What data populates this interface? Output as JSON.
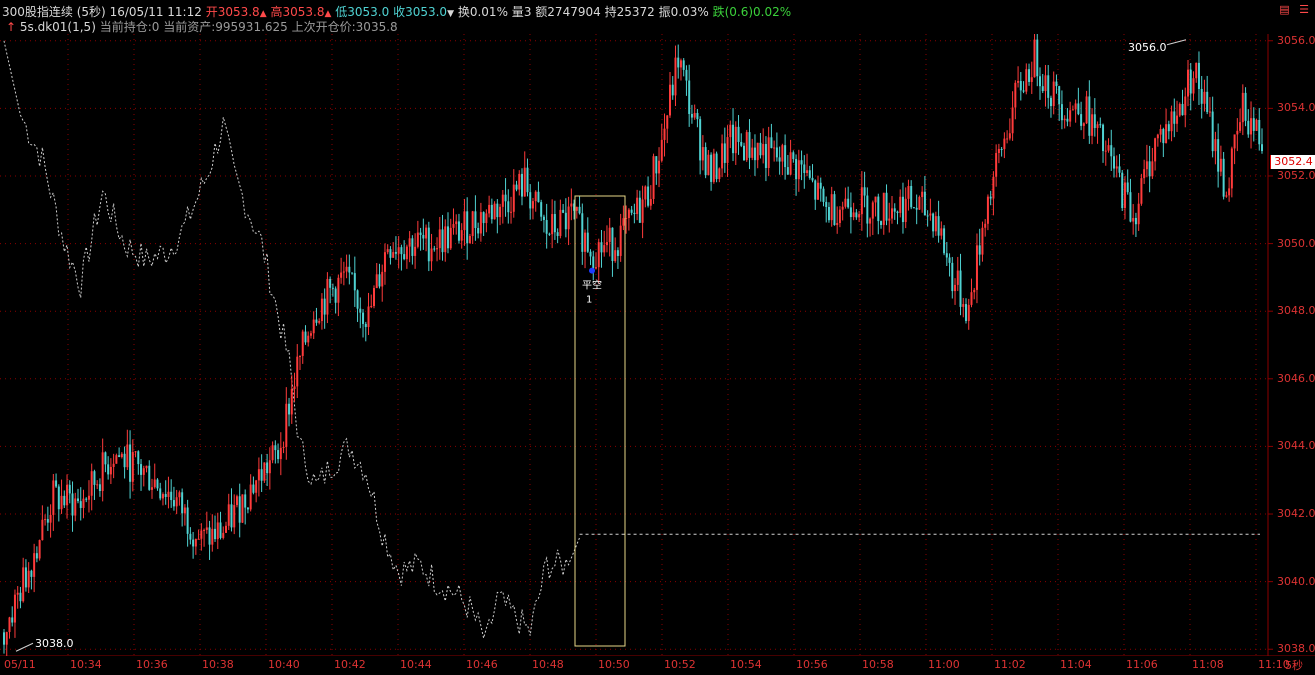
{
  "header": {
    "name": "300股指连续",
    "period": "(5秒)",
    "datetime": "16/05/11 11:12",
    "open_label": "开",
    "open": "3053.8",
    "high_label": "高",
    "high": "3053.8",
    "low_label": "低",
    "low": "3053.0",
    "close_label": "收",
    "close": "3053.0",
    "turnover_label": "换",
    "turnover": "0.01%",
    "volume_label": "量",
    "volume": "3",
    "amount_label": "额",
    "amount": "2747904",
    "oi_label": "持",
    "oi": "25372",
    "amplitude_label": "振",
    "amplitude": "0.03%",
    "change_label": "跌",
    "change": "(0.6)0.02%",
    "arrow_up": "▲",
    "arrow_down": "▼"
  },
  "strategy": {
    "icon_arrow": "↑",
    "name": "5s.dk01(1,5)",
    "position_label": "当前持仓:",
    "position": "0",
    "assets_label": "当前资产:",
    "assets": "995931.625",
    "last_open_label": "上次开仓价:",
    "last_open": "3035.8"
  },
  "annotations": {
    "high_label": "3056.0",
    "low_label": "3038.0",
    "signal_label": "平空",
    "signal_count": "1"
  },
  "colors": {
    "up": "#ff3b3b",
    "down": "#4fd2d2",
    "grid": "#8b0000",
    "axis_text": "#dd3333",
    "box": "#e8d888",
    "signal": "#1e3cff"
  },
  "current_price": "3052.4",
  "axis_period": "5秒",
  "chart_data": {
    "type": "candlestick",
    "ylim": [
      3037.8,
      3056.2
    ],
    "y_ticks": [
      "3038.0",
      "3040.0",
      "3042.0",
      "3044.0",
      "3046.0",
      "3048.0",
      "3050.0",
      "3052.0",
      "3054.0",
      "3056.0"
    ],
    "x_ticks": [
      "05/11",
      "10:34",
      "10:36",
      "10:38",
      "10:40",
      "10:42",
      "10:44",
      "10:46",
      "10:48",
      "10:50",
      "10:52",
      "10:54",
      "10:56",
      "10:58",
      "11:00",
      "11:02",
      "11:04",
      "11:06",
      "11:08",
      "11:10"
    ],
    "close_anchors": [
      [
        0,
        3038.5
      ],
      [
        8,
        3040.2
      ],
      [
        18,
        3042.5
      ],
      [
        28,
        3042.3
      ],
      [
        40,
        3043.8
      ],
      [
        52,
        3043.2
      ],
      [
        62,
        3042.5
      ],
      [
        72,
        3041.2
      ],
      [
        80,
        3041.5
      ],
      [
        90,
        3042.8
      ],
      [
        100,
        3043.8
      ],
      [
        106,
        3046.0
      ],
      [
        113,
        3048.0
      ],
      [
        124,
        3049.0
      ],
      [
        133,
        3047.8
      ],
      [
        140,
        3050.0
      ],
      [
        155,
        3050.0
      ],
      [
        165,
        3050.3
      ],
      [
        174,
        3050.8
      ],
      [
        182,
        3051.2
      ],
      [
        190,
        3051.8
      ],
      [
        198,
        3050.3
      ],
      [
        207,
        3050.8
      ],
      [
        215,
        3049.8
      ],
      [
        222,
        3050.0
      ],
      [
        228,
        3050.5
      ],
      [
        235,
        3051.5
      ],
      [
        240,
        3053.0
      ],
      [
        246,
        3055.5
      ],
      [
        252,
        3053.5
      ],
      [
        258,
        3052.0
      ],
      [
        265,
        3053.0
      ],
      [
        275,
        3052.8
      ],
      [
        282,
        3052.5
      ],
      [
        290,
        3052.3
      ],
      [
        300,
        3051.0
      ],
      [
        310,
        3051.3
      ],
      [
        318,
        3051.0
      ],
      [
        330,
        3051.2
      ],
      [
        340,
        3050.8
      ],
      [
        346,
        3049.0
      ],
      [
        352,
        3048.0
      ],
      [
        358,
        3051.0
      ],
      [
        364,
        3052.8
      ],
      [
        370,
        3054.5
      ],
      [
        376,
        3055.5
      ],
      [
        382,
        3054.5
      ],
      [
        388,
        3054.0
      ],
      [
        394,
        3054.0
      ],
      [
        400,
        3053.0
      ],
      [
        406,
        3052.0
      ],
      [
        412,
        3050.8
      ],
      [
        420,
        3053.0
      ],
      [
        428,
        3053.8
      ],
      [
        434,
        3055.2
      ],
      [
        440,
        3053.5
      ],
      [
        446,
        3051.5
      ],
      [
        452,
        3054.0
      ],
      [
        459,
        3053.0
      ]
    ],
    "shadow_line_anchors": [
      [
        0,
        3056.0
      ],
      [
        6,
        3053.8
      ],
      [
        14,
        3052.5
      ],
      [
        22,
        3050.0
      ],
      [
        28,
        3048.8
      ],
      [
        36,
        3051.5
      ],
      [
        44,
        3050.0
      ],
      [
        52,
        3049.5
      ],
      [
        60,
        3049.8
      ],
      [
        66,
        3050.5
      ],
      [
        74,
        3052.0
      ],
      [
        80,
        3053.5
      ],
      [
        84,
        3052.0
      ],
      [
        94,
        3050.0
      ],
      [
        104,
        3046.5
      ],
      [
        108,
        3044.0
      ],
      [
        114,
        3042.8
      ],
      [
        120,
        3043.5
      ],
      [
        126,
        3044.0
      ],
      [
        132,
        3043.3
      ],
      [
        138,
        3041.5
      ],
      [
        144,
        3040.3
      ],
      [
        152,
        3040.5
      ],
      [
        158,
        3040.0
      ],
      [
        164,
        3039.7
      ],
      [
        170,
        3039.2
      ],
      [
        176,
        3038.2
      ],
      [
        180,
        3039.5
      ],
      [
        186,
        3039.0
      ],
      [
        192,
        3038.5
      ],
      [
        198,
        3040.5
      ],
      [
        206,
        3040.5
      ],
      [
        210,
        3041.3
      ],
      [
        459,
        3041.3
      ]
    ],
    "n_bars": 460,
    "signal": {
      "label": "平空",
      "count": 1,
      "price": 3049.2
    },
    "high_annotation": 3056.0,
    "low_annotation": 3038.0,
    "reference_price": 3041.4
  }
}
